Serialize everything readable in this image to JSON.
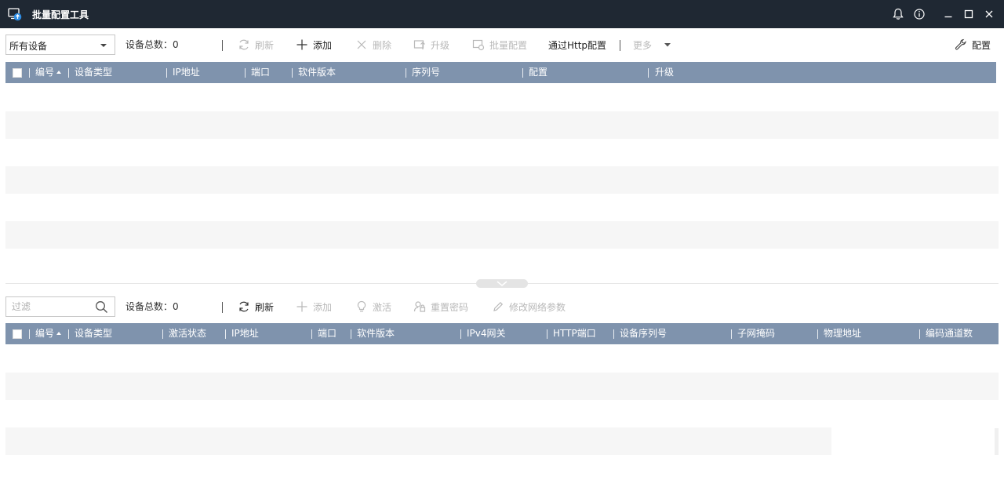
{
  "window": {
    "title": "批量配置工具"
  },
  "top_toolbar": {
    "device_filter": {
      "selected": "所有设备"
    },
    "total_label": "设备总数：0",
    "refresh": "刷新",
    "add": "添加",
    "delete": "删除",
    "upgrade": "升级",
    "batch_config": "批量配置",
    "http_config": "通过Http配置",
    "more": "更多",
    "config": "配置"
  },
  "top_table": {
    "columns": [
      "编号",
      "设备类型",
      "IP地址",
      "端口",
      "软件版本",
      "序列号",
      "配置",
      "升级"
    ]
  },
  "bottom_toolbar": {
    "filter_placeholder": "过滤",
    "total_label": "设备总数：0",
    "refresh": "刷新",
    "add": "添加",
    "activate": "激活",
    "reset_password": "重置密码",
    "modify_network": "修改网络参数"
  },
  "bottom_table": {
    "columns": [
      "编号",
      "设备类型",
      "激活状态",
      "IP地址",
      "端口",
      "软件版本",
      "IPv4网关",
      "HTTP端口",
      "设备序列号",
      "子网掩码",
      "物理地址",
      "编码通道数"
    ]
  }
}
